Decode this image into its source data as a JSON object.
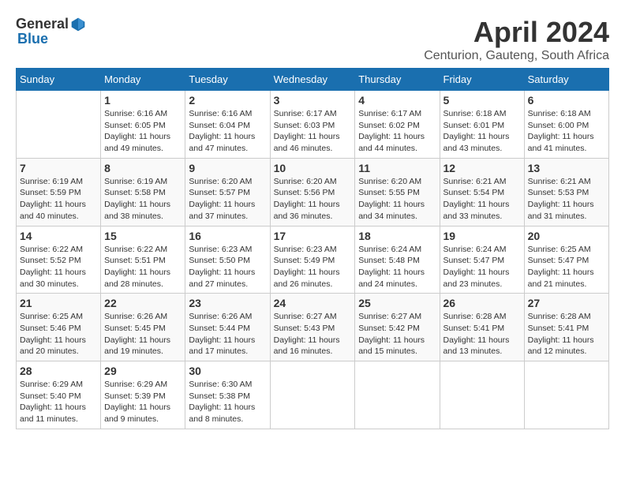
{
  "header": {
    "logo_general": "General",
    "logo_blue": "Blue",
    "title": "April 2024",
    "location": "Centurion, Gauteng, South Africa"
  },
  "days_of_week": [
    "Sunday",
    "Monday",
    "Tuesday",
    "Wednesday",
    "Thursday",
    "Friday",
    "Saturday"
  ],
  "weeks": [
    [
      {
        "day": "",
        "info": ""
      },
      {
        "day": "1",
        "info": "Sunrise: 6:16 AM\nSunset: 6:05 PM\nDaylight: 11 hours\nand 49 minutes."
      },
      {
        "day": "2",
        "info": "Sunrise: 6:16 AM\nSunset: 6:04 PM\nDaylight: 11 hours\nand 47 minutes."
      },
      {
        "day": "3",
        "info": "Sunrise: 6:17 AM\nSunset: 6:03 PM\nDaylight: 11 hours\nand 46 minutes."
      },
      {
        "day": "4",
        "info": "Sunrise: 6:17 AM\nSunset: 6:02 PM\nDaylight: 11 hours\nand 44 minutes."
      },
      {
        "day": "5",
        "info": "Sunrise: 6:18 AM\nSunset: 6:01 PM\nDaylight: 11 hours\nand 43 minutes."
      },
      {
        "day": "6",
        "info": "Sunrise: 6:18 AM\nSunset: 6:00 PM\nDaylight: 11 hours\nand 41 minutes."
      }
    ],
    [
      {
        "day": "7",
        "info": "Sunrise: 6:19 AM\nSunset: 5:59 PM\nDaylight: 11 hours\nand 40 minutes."
      },
      {
        "day": "8",
        "info": "Sunrise: 6:19 AM\nSunset: 5:58 PM\nDaylight: 11 hours\nand 38 minutes."
      },
      {
        "day": "9",
        "info": "Sunrise: 6:20 AM\nSunset: 5:57 PM\nDaylight: 11 hours\nand 37 minutes."
      },
      {
        "day": "10",
        "info": "Sunrise: 6:20 AM\nSunset: 5:56 PM\nDaylight: 11 hours\nand 36 minutes."
      },
      {
        "day": "11",
        "info": "Sunrise: 6:20 AM\nSunset: 5:55 PM\nDaylight: 11 hours\nand 34 minutes."
      },
      {
        "day": "12",
        "info": "Sunrise: 6:21 AM\nSunset: 5:54 PM\nDaylight: 11 hours\nand 33 minutes."
      },
      {
        "day": "13",
        "info": "Sunrise: 6:21 AM\nSunset: 5:53 PM\nDaylight: 11 hours\nand 31 minutes."
      }
    ],
    [
      {
        "day": "14",
        "info": "Sunrise: 6:22 AM\nSunset: 5:52 PM\nDaylight: 11 hours\nand 30 minutes."
      },
      {
        "day": "15",
        "info": "Sunrise: 6:22 AM\nSunset: 5:51 PM\nDaylight: 11 hours\nand 28 minutes."
      },
      {
        "day": "16",
        "info": "Sunrise: 6:23 AM\nSunset: 5:50 PM\nDaylight: 11 hours\nand 27 minutes."
      },
      {
        "day": "17",
        "info": "Sunrise: 6:23 AM\nSunset: 5:49 PM\nDaylight: 11 hours\nand 26 minutes."
      },
      {
        "day": "18",
        "info": "Sunrise: 6:24 AM\nSunset: 5:48 PM\nDaylight: 11 hours\nand 24 minutes."
      },
      {
        "day": "19",
        "info": "Sunrise: 6:24 AM\nSunset: 5:47 PM\nDaylight: 11 hours\nand 23 minutes."
      },
      {
        "day": "20",
        "info": "Sunrise: 6:25 AM\nSunset: 5:47 PM\nDaylight: 11 hours\nand 21 minutes."
      }
    ],
    [
      {
        "day": "21",
        "info": "Sunrise: 6:25 AM\nSunset: 5:46 PM\nDaylight: 11 hours\nand 20 minutes."
      },
      {
        "day": "22",
        "info": "Sunrise: 6:26 AM\nSunset: 5:45 PM\nDaylight: 11 hours\nand 19 minutes."
      },
      {
        "day": "23",
        "info": "Sunrise: 6:26 AM\nSunset: 5:44 PM\nDaylight: 11 hours\nand 17 minutes."
      },
      {
        "day": "24",
        "info": "Sunrise: 6:27 AM\nSunset: 5:43 PM\nDaylight: 11 hours\nand 16 minutes."
      },
      {
        "day": "25",
        "info": "Sunrise: 6:27 AM\nSunset: 5:42 PM\nDaylight: 11 hours\nand 15 minutes."
      },
      {
        "day": "26",
        "info": "Sunrise: 6:28 AM\nSunset: 5:41 PM\nDaylight: 11 hours\nand 13 minutes."
      },
      {
        "day": "27",
        "info": "Sunrise: 6:28 AM\nSunset: 5:41 PM\nDaylight: 11 hours\nand 12 minutes."
      }
    ],
    [
      {
        "day": "28",
        "info": "Sunrise: 6:29 AM\nSunset: 5:40 PM\nDaylight: 11 hours\nand 11 minutes."
      },
      {
        "day": "29",
        "info": "Sunrise: 6:29 AM\nSunset: 5:39 PM\nDaylight: 11 hours\nand 9 minutes."
      },
      {
        "day": "30",
        "info": "Sunrise: 6:30 AM\nSunset: 5:38 PM\nDaylight: 11 hours\nand 8 minutes."
      },
      {
        "day": "",
        "info": ""
      },
      {
        "day": "",
        "info": ""
      },
      {
        "day": "",
        "info": ""
      },
      {
        "day": "",
        "info": ""
      }
    ]
  ]
}
